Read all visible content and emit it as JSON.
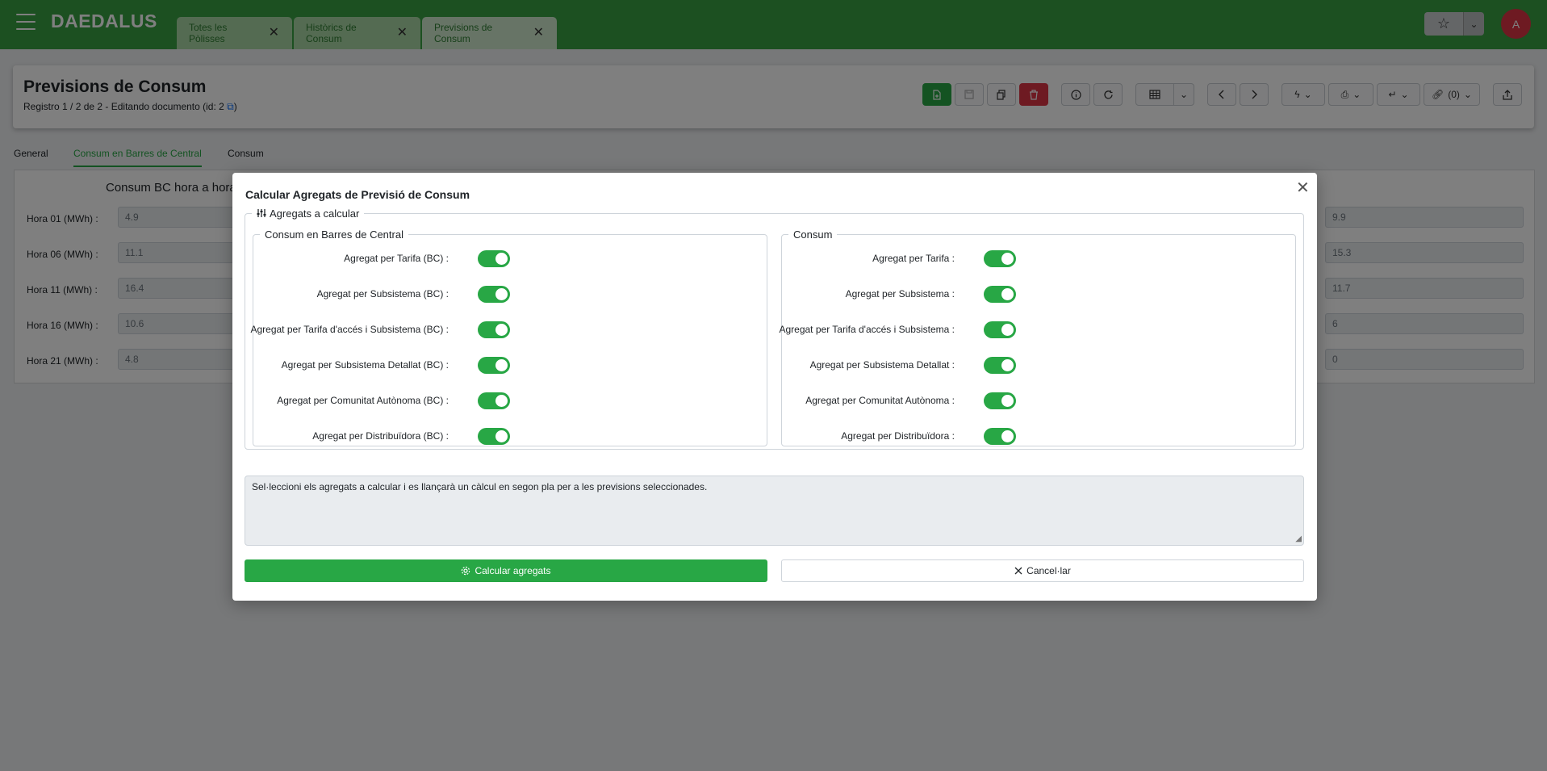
{
  "app": {
    "brand": "DAEDALUS",
    "avatar_initial": "A"
  },
  "tabs": [
    {
      "label": "Totes les Pòlisses",
      "close": "✕"
    },
    {
      "label": "Històrics de Consum",
      "close": "✕"
    },
    {
      "label": "Previsions de Consum",
      "close": "✕"
    }
  ],
  "header": {
    "title": "Previsions de Consum",
    "subtitle": "Registro 1 / 2 de 2 - Editando documento (id: 2 ",
    "subtitle_end": ")",
    "links_label": "(0)"
  },
  "subtabs": [
    "General",
    "Consum en Barres de Central",
    "Consum"
  ],
  "form": {
    "section_title": "Consum BC hora a hora",
    "rows": [
      {
        "label": "Hora 01 (MWh) :",
        "value": "4.9",
        "right_value": "9.9"
      },
      {
        "label": "Hora 06 (MWh) :",
        "value": "11.1",
        "right_value": "15.3"
      },
      {
        "label": "Hora 11 (MWh) :",
        "value": "16.4",
        "right_value": "11.7"
      },
      {
        "label": "Hora 16 (MWh) :",
        "value": "10.6",
        "right_value": "6"
      },
      {
        "label": "Hora 21 (MWh) :",
        "value": "4.8",
        "right_value": "0"
      }
    ]
  },
  "modal": {
    "title": "Calcular Agregats de Previsió de Consum",
    "close": "✕",
    "outer_legend": "Agregats a calcular",
    "bc": {
      "legend": "Consum en Barres de Central",
      "options": [
        {
          "label": "Agregat per Tarifa (BC) :",
          "on": true
        },
        {
          "label": "Agregat per Subsistema (BC) :",
          "on": true
        },
        {
          "label": "Agregat per Tarifa d'accés i Subsistema (BC) :",
          "on": true
        },
        {
          "label": "Agregat per Subsistema Detallat (BC) :",
          "on": true
        },
        {
          "label": "Agregat per Comunitat Autònoma (BC) :",
          "on": true
        },
        {
          "label": "Agregat per Distribuïdora (BC) :",
          "on": true
        }
      ]
    },
    "consum": {
      "legend": "Consum",
      "options": [
        {
          "label": "Agregat per Tarifa :",
          "on": true
        },
        {
          "label": "Agregat per Subsistema :",
          "on": true
        },
        {
          "label": "Agregat per Tarifa d'accés i Subsistema :",
          "on": true
        },
        {
          "label": "Agregat per Subsistema Detallat :",
          "on": true
        },
        {
          "label": "Agregat per Comunitat Autònoma :",
          "on": true
        },
        {
          "label": "Agregat per Distribuïdora :",
          "on": true
        }
      ]
    },
    "info_text": "Sel·leccioni els agregats a calcular i es llançarà un càlcul en segon pla per a les previsions seleccionades.",
    "calc_button": "Calcular agregats",
    "cancel_button": "Cancel·lar"
  },
  "colors": {
    "topbar": "#38a043",
    "accent": "#28a745",
    "danger": "#dc3545"
  }
}
